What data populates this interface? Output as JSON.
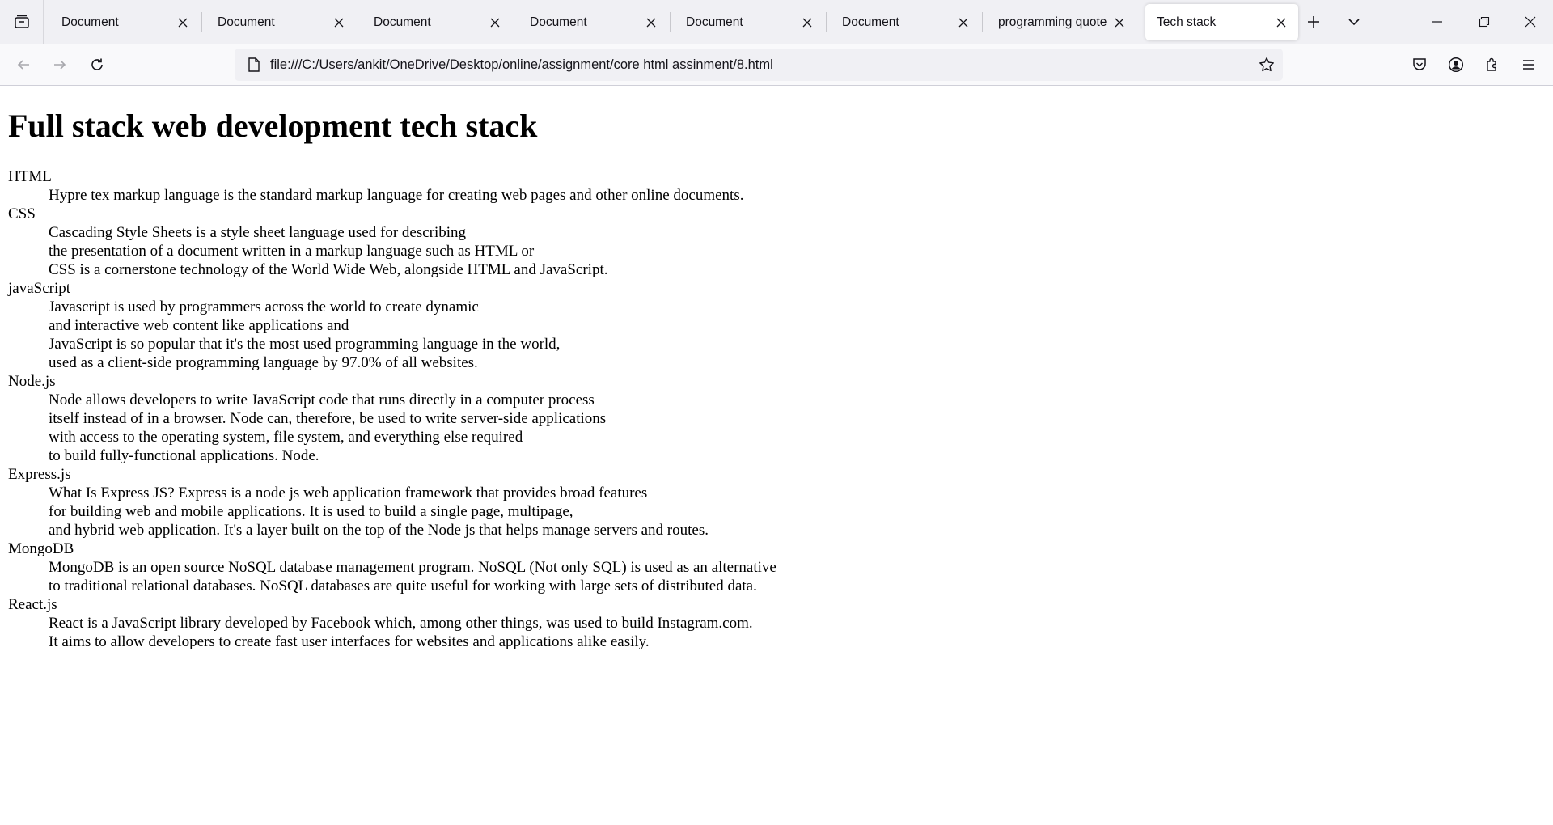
{
  "tabs": [
    {
      "label": "Document",
      "active": false
    },
    {
      "label": "Document",
      "active": false
    },
    {
      "label": "Document",
      "active": false
    },
    {
      "label": "Document",
      "active": false
    },
    {
      "label": "Document",
      "active": false
    },
    {
      "label": "Document",
      "active": false
    },
    {
      "label": "programming quotes",
      "active": false
    },
    {
      "label": "Tech stack",
      "active": true
    }
  ],
  "address_bar": {
    "url": "file:///C:/Users/ankit/OneDrive/Desktop/online/assignment/core html assinment/8.html"
  },
  "icons": {
    "tab_manager": "tab-manager-icon",
    "tab_close": "close-icon",
    "new_tab": "plus-icon",
    "list_tabs": "chevron-down-icon",
    "minimize": "minimize-icon",
    "restore": "restore-icon",
    "close_window": "close-icon",
    "back": "arrow-left-icon",
    "forward": "arrow-right-icon",
    "reload": "reload-icon",
    "page": "page-icon",
    "bookmark": "star-icon",
    "pocket": "pocket-icon",
    "account": "account-icon",
    "extensions": "puzzle-icon",
    "menu": "hamburger-menu-icon"
  },
  "page": {
    "heading": "Full stack web development tech stack",
    "terms": [
      {
        "term": "HTML",
        "lines": [
          "Hypre tex markup language is the standard markup language for creating web pages and other online documents."
        ]
      },
      {
        "term": "CSS",
        "lines": [
          "Cascading Style Sheets is a style sheet language used for describing",
          "the presentation of a document written in a markup language such as HTML or",
          "CSS is a cornerstone technology of the World Wide Web, alongside HTML and JavaScript."
        ]
      },
      {
        "term": "javaScript",
        "lines": [
          "Javascript is used by programmers across the world to create dynamic",
          "and interactive web content like applications and",
          "JavaScript is so popular that it's the most used programming language in the world,",
          "used as a client-side programming language by 97.0% of all websites."
        ]
      },
      {
        "term": "Node.js",
        "lines": [
          "Node allows developers to write JavaScript code that runs directly in a computer process",
          "itself instead of in a browser. Node can, therefore, be used to write server-side applications",
          "with access to the operating system, file system, and everything else required",
          "to build fully-functional applications. Node."
        ]
      },
      {
        "term": "Express.js",
        "lines": [
          "What Is Express JS? Express is a node js web application framework that provides broad features",
          "for building web and mobile applications. It is used to build a single page, multipage,",
          "and hybrid web application. It's a layer built on the top of the Node js that helps manage servers and routes."
        ]
      },
      {
        "term": "MongoDB",
        "lines": [
          "MongoDB is an open source NoSQL database management program. NoSQL (Not only SQL) is used as an alternative",
          "to traditional relational databases. NoSQL databases are quite useful for working with large sets of distributed data."
        ]
      },
      {
        "term": "React.js",
        "lines": [
          "React is a JavaScript library developed by Facebook which, among other things, was used to build Instagram.com.",
          "It aims to allow developers to create fast user interfaces for websites and applications alike easily."
        ]
      }
    ]
  }
}
